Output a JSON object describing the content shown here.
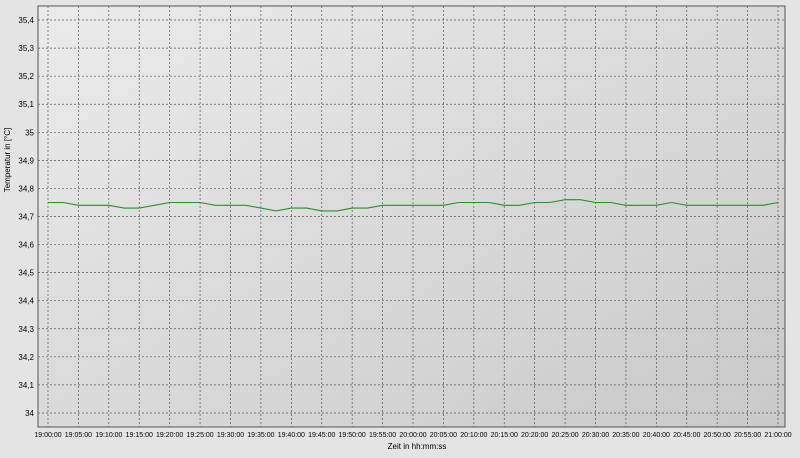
{
  "chart_data": {
    "type": "line",
    "title": "",
    "xlabel": "Zeit in hh:mm:ss",
    "ylabel": "Temperatur in [°C]",
    "ylim": [
      33.95,
      35.45
    ],
    "y_ticks": [
      "34",
      "34,1",
      "34,2",
      "34,3",
      "34,4",
      "34,5",
      "34,6",
      "34,7",
      "34,8",
      "34,9",
      "35",
      "35,1",
      "35,2",
      "35,3",
      "35,4"
    ],
    "y_tick_values": [
      34.0,
      34.1,
      34.2,
      34.3,
      34.4,
      34.5,
      34.6,
      34.7,
      34.8,
      34.9,
      35.0,
      35.1,
      35.2,
      35.3,
      35.4
    ],
    "x_ticks": [
      "19:00:00",
      "19:05:00",
      "19:10:00",
      "19:15:00",
      "19:20:00",
      "19:25:00",
      "19:30:00",
      "19:35:00",
      "19:40:00",
      "19:45:00",
      "19:50:00",
      "19:55:00",
      "20:00:00",
      "20:05:00",
      "20:10:00",
      "20:15:00",
      "20:20:00",
      "20:25:00",
      "20:30:00",
      "20:35:00",
      "20:40:00",
      "20:45:00",
      "20:50:00",
      "20:55:00",
      "21:00:00"
    ],
    "grid": true,
    "legend": "none",
    "series": [
      {
        "color": "#2e8b2e",
        "x": [
          "19:00:00",
          "19:02:30",
          "19:05:00",
          "19:07:30",
          "19:10:00",
          "19:12:30",
          "19:15:00",
          "19:17:30",
          "19:20:00",
          "19:22:30",
          "19:25:00",
          "19:27:30",
          "19:30:00",
          "19:32:30",
          "19:35:00",
          "19:37:30",
          "19:40:00",
          "19:42:30",
          "19:45:00",
          "19:47:30",
          "19:50:00",
          "19:52:30",
          "19:55:00",
          "19:57:30",
          "20:00:00",
          "20:02:30",
          "20:05:00",
          "20:07:30",
          "20:10:00",
          "20:12:30",
          "20:15:00",
          "20:17:30",
          "20:20:00",
          "20:22:30",
          "20:25:00",
          "20:27:30",
          "20:30:00",
          "20:32:30",
          "20:35:00",
          "20:37:30",
          "20:40:00",
          "20:42:30",
          "20:45:00",
          "20:47:30",
          "20:50:00",
          "20:52:30",
          "20:55:00",
          "20:57:30",
          "21:00:00"
        ],
        "values": [
          34.75,
          34.75,
          34.74,
          34.74,
          34.74,
          34.73,
          34.73,
          34.74,
          34.75,
          34.75,
          34.75,
          34.74,
          34.74,
          34.74,
          34.73,
          34.72,
          34.73,
          34.73,
          34.72,
          34.72,
          34.73,
          34.73,
          34.74,
          34.74,
          34.74,
          34.74,
          34.74,
          34.75,
          34.75,
          34.75,
          34.74,
          34.74,
          34.75,
          34.75,
          34.76,
          34.76,
          34.75,
          34.75,
          34.74,
          34.74,
          34.74,
          34.75,
          34.74,
          34.74,
          34.74,
          34.74,
          34.74,
          34.74,
          34.75
        ]
      }
    ]
  }
}
